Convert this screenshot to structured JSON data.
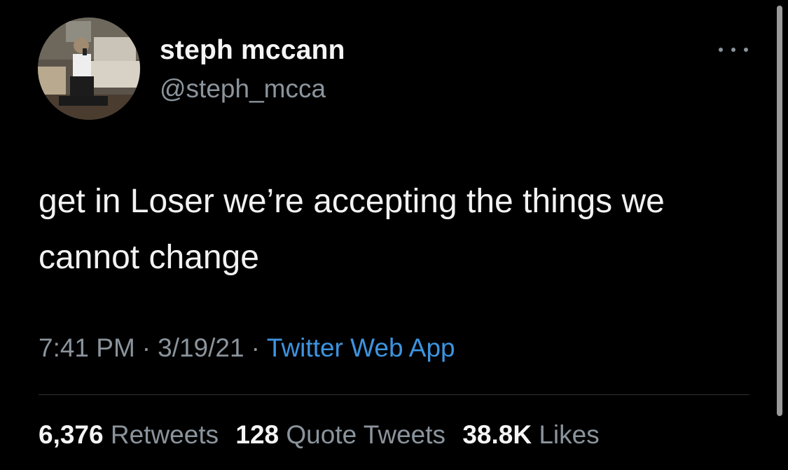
{
  "tweet": {
    "author": {
      "display_name": "steph mccann",
      "handle": "@steph_mcca"
    },
    "more_icon": "more-horizontal-icon",
    "text": "get in Loser we’re accepting the things we cannot change",
    "meta": {
      "time": "7:41 PM",
      "separator": "·",
      "date": "3/19/21",
      "source": "Twitter Web App"
    },
    "stats": {
      "retweets": {
        "count": "6,376",
        "label": "Retweets"
      },
      "quote_tweets": {
        "count": "128",
        "label": "Quote Tweets"
      },
      "likes": {
        "count": "38.8K",
        "label": "Likes"
      }
    }
  },
  "colors": {
    "background": "#000000",
    "primary_text": "#f5f5f5",
    "secondary_text": "#8b949c",
    "link": "#3d94e0",
    "divider": "#2f3336"
  }
}
